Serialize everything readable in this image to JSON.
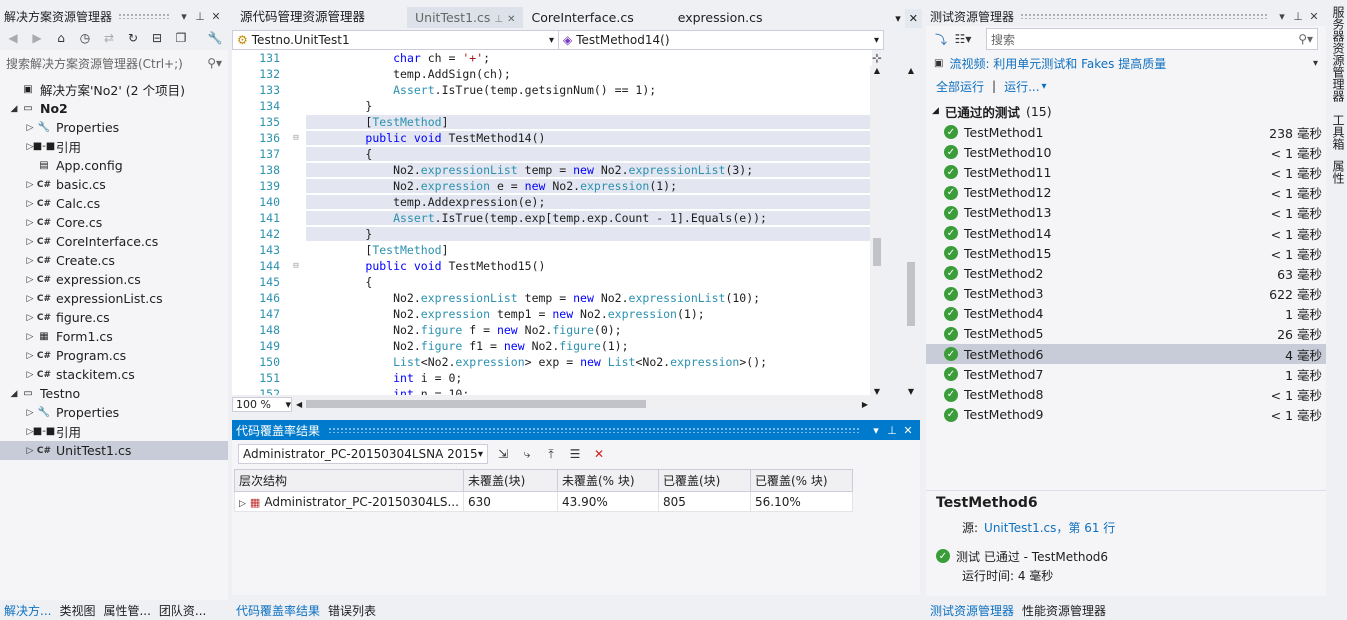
{
  "solution_explorer": {
    "title": "解决方案资源管理器",
    "search_placeholder": "搜索解决方案资源管理器(Ctrl+;)",
    "solution_label": "解决方案'No2' (2 个项目)",
    "projects": [
      {
        "name": "No2",
        "items": [
          {
            "label": "Properties",
            "icon": "wrench-icon",
            "expander": true
          },
          {
            "label": "引用",
            "icon": "references-icon",
            "expander": true
          },
          {
            "label": "App.config",
            "icon": "config-icon",
            "expander": false
          },
          {
            "label": "basic.cs",
            "icon": "csharp-icon",
            "expander": true
          },
          {
            "label": "Calc.cs",
            "icon": "csharp-icon",
            "expander": true
          },
          {
            "label": "Core.cs",
            "icon": "csharp-icon",
            "expander": true
          },
          {
            "label": "CoreInterface.cs",
            "icon": "csharp-icon",
            "expander": true
          },
          {
            "label": "Create.cs",
            "icon": "csharp-icon",
            "expander": true
          },
          {
            "label": "expression.cs",
            "icon": "csharp-icon",
            "expander": true
          },
          {
            "label": "expressionList.cs",
            "icon": "csharp-icon",
            "expander": true
          },
          {
            "label": "figure.cs",
            "icon": "csharp-icon",
            "expander": true
          },
          {
            "label": "Form1.cs",
            "icon": "form-icon",
            "expander": true
          },
          {
            "label": "Program.cs",
            "icon": "csharp-icon",
            "expander": true
          },
          {
            "label": "stackitem.cs",
            "icon": "csharp-icon",
            "expander": true
          }
        ]
      },
      {
        "name": "Testno",
        "items": [
          {
            "label": "Properties",
            "icon": "wrench-icon",
            "expander": true
          },
          {
            "label": "引用",
            "icon": "references-icon",
            "expander": true
          },
          {
            "label": "UnitTest1.cs",
            "icon": "csharp-icon",
            "expander": true
          }
        ]
      }
    ],
    "bottom_tabs": [
      "解决方...",
      "类视图",
      "属性管...",
      "团队资..."
    ]
  },
  "editor": {
    "tabs": [
      "源代码管理资源管理器",
      "UnitTest1.cs",
      "CoreInterface.cs",
      "expression.cs"
    ],
    "class_nav": "Testno.UnitTest1",
    "member_nav": "TestMethod14()",
    "zoom": "100 %",
    "lines": [
      {
        "n": "131",
        "code": "            char ch = '+';",
        "hl": false
      },
      {
        "n": "132",
        "code": "            temp.AddSign(ch);",
        "hl": false
      },
      {
        "n": "133",
        "code": "            Assert.IsTrue(temp.getsignNum() == 1);",
        "hl": false
      },
      {
        "n": "134",
        "code": "        }",
        "hl": false
      },
      {
        "n": "135",
        "code": "        [TestMethod]",
        "hl": true
      },
      {
        "n": "136",
        "code": "        public void TestMethod14()",
        "hl": true
      },
      {
        "n": "137",
        "code": "        {",
        "hl": true
      },
      {
        "n": "138",
        "code": "            No2.expressionList temp = new No2.expressionList(3);",
        "hl": true
      },
      {
        "n": "139",
        "code": "            No2.expression e = new No2.expression(1);",
        "hl": true
      },
      {
        "n": "140",
        "code": "            temp.Addexpression(e);",
        "hl": true
      },
      {
        "n": "141",
        "code": "            Assert.IsTrue(temp.exp[temp.exp.Count - 1].Equals(e));",
        "hl": true
      },
      {
        "n": "142",
        "code": "        }",
        "hl": true
      },
      {
        "n": "143",
        "code": "        [TestMethod]",
        "hl": false
      },
      {
        "n": "144",
        "code": "        public void TestMethod15()",
        "hl": false
      },
      {
        "n": "145",
        "code": "        {",
        "hl": false
      },
      {
        "n": "146",
        "code": "            No2.expressionList temp = new No2.expressionList(10);",
        "hl": false
      },
      {
        "n": "147",
        "code": "            No2.expression temp1 = new No2.expression(1);",
        "hl": false
      },
      {
        "n": "148",
        "code": "            No2.figure f = new No2.figure(0);",
        "hl": false
      },
      {
        "n": "149",
        "code": "            No2.figure f1 = new No2.figure(1);",
        "hl": false
      },
      {
        "n": "150",
        "code": "            List<No2.expression> exp = new List<No2.expression>();",
        "hl": false
      },
      {
        "n": "151",
        "code": "            int i = 0;",
        "hl": false
      },
      {
        "n": "152",
        "code": "            int n = 10;",
        "hl": false
      }
    ]
  },
  "coverage": {
    "title": "代码覆盖率结果",
    "session": "Administrator_PC-20150304LSNA 2015-",
    "headers": [
      "层次结构",
      "未覆盖(块)",
      "未覆盖(% 块)",
      "已覆盖(块)",
      "已覆盖(% 块)"
    ],
    "row": [
      "Administrator_PC-20150304LS...",
      "630",
      "43.90%",
      "805",
      "56.10%"
    ],
    "bottom_tabs": [
      "代码覆盖率结果",
      "错误列表"
    ]
  },
  "test_explorer": {
    "title": "测试资源管理器",
    "search_placeholder": "搜索",
    "promo": "流视频: 利用单元测试和 Fakes 提高质量",
    "run_all": "全部运行",
    "run": "运行...",
    "group_label": "已通过的测试",
    "group_count": "(15)",
    "tests": [
      {
        "name": "TestMethod1",
        "dur": "238 毫秒"
      },
      {
        "name": "TestMethod10",
        "dur": "< 1 毫秒"
      },
      {
        "name": "TestMethod11",
        "dur": "< 1 毫秒"
      },
      {
        "name": "TestMethod12",
        "dur": "< 1 毫秒"
      },
      {
        "name": "TestMethod13",
        "dur": "< 1 毫秒"
      },
      {
        "name": "TestMethod14",
        "dur": "< 1 毫秒"
      },
      {
        "name": "TestMethod15",
        "dur": "< 1 毫秒"
      },
      {
        "name": "TestMethod2",
        "dur": "63 毫秒"
      },
      {
        "name": "TestMethod3",
        "dur": "622 毫秒"
      },
      {
        "name": "TestMethod4",
        "dur": "1 毫秒"
      },
      {
        "name": "TestMethod5",
        "dur": "26 毫秒"
      },
      {
        "name": "TestMethod6",
        "dur": "4 毫秒"
      },
      {
        "name": "TestMethod7",
        "dur": "1 毫秒"
      },
      {
        "name": "TestMethod8",
        "dur": "< 1 毫秒"
      },
      {
        "name": "TestMethod9",
        "dur": "< 1 毫秒"
      }
    ],
    "selected_index": 11,
    "detail": {
      "name": "TestMethod6",
      "source_label": "源:",
      "source_link": "UnitTest1.cs，第 61 行",
      "status": "测试 已通过 - TestMethod6",
      "elapsed": "运行时间: 4 毫秒"
    },
    "bottom_tabs": [
      "测试资源管理器",
      "性能资源管理器"
    ]
  },
  "side_tabs": [
    "服务器资源管理器",
    "工具箱",
    "属性"
  ]
}
